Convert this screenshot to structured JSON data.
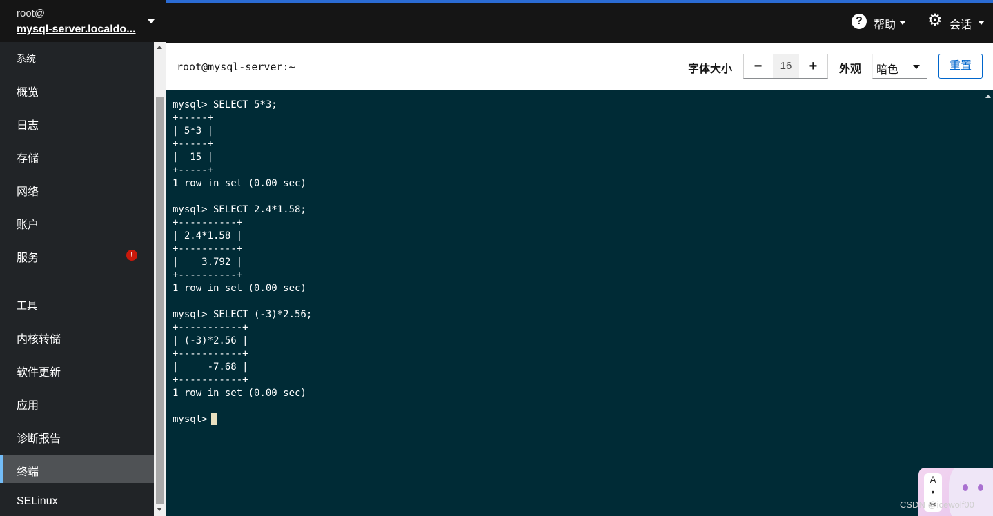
{
  "host": {
    "user": "root@",
    "name": "mysql-server.localdo..."
  },
  "nav": {
    "section_system": "系统",
    "system_items": [
      "概览",
      "日志",
      "存储",
      "网络",
      "账户",
      "服务"
    ],
    "section_tools": "工具",
    "tools_items": [
      "内核转储",
      "软件更新",
      "应用",
      "诊断报告",
      "终端",
      "SELinux"
    ],
    "active": "终端",
    "alert_item": "服务"
  },
  "topbar": {
    "help_label": "帮助",
    "session_label": "会话"
  },
  "terminal_header": {
    "title": "root@mysql-server:~",
    "font_size_label": "字体大小",
    "font_size_value": "16",
    "minus": "−",
    "plus": "+",
    "appearance_label": "外观",
    "appearance_value": "暗色",
    "reset_label": "重置"
  },
  "terminal": {
    "lines": [
      "mysql> SELECT 5*3;",
      "+-----+",
      "| 5*3 |",
      "+-----+",
      "|  15 |",
      "+-----+",
      "1 row in set (0.00 sec)",
      "",
      "mysql> SELECT 2.4*1.58;",
      "+----------+",
      "| 2.4*1.58 |",
      "+----------+",
      "|    3.792 |",
      "+----------+",
      "1 row in set (0.00 sec)",
      "",
      "mysql> SELECT (-3)*2.56;",
      "+-----------+",
      "| (-3)*2.56 |",
      "+-----------+",
      "|     -7.68 |",
      "+-----------+",
      "1 row in set (0.00 sec)",
      "",
      "mysql> "
    ],
    "background": "#002b36"
  },
  "widget": {
    "tool_glyphs": [
      "A",
      "•",
      "✂"
    ]
  },
  "watermark": "CSDN @icewolf00",
  "colors": {
    "accent": "#0066cc",
    "topbar_stripe": "#2b6cd4",
    "alert": "#c9190b",
    "active_marker": "#73bcf7"
  }
}
